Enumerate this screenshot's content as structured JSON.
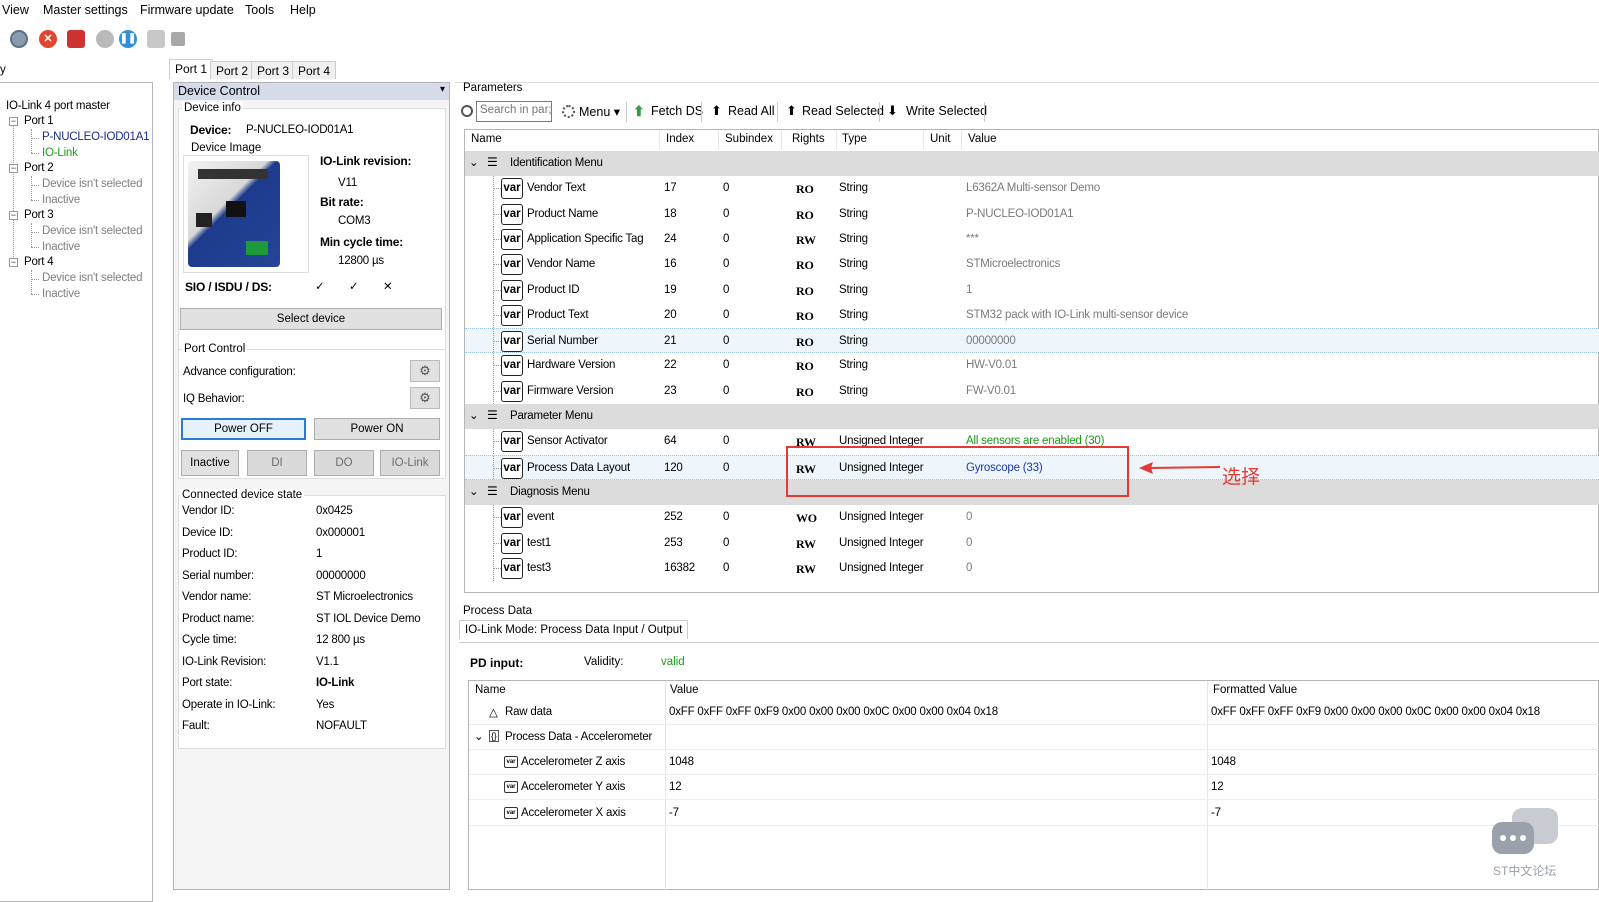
{
  "menubar": {
    "items": [
      "View",
      "Master settings",
      "Firmware update",
      "Tools",
      "Help"
    ]
  },
  "toolbar": {
    "icons": [
      "settings-gear-icon",
      "stop-red-icon",
      "disconnect-icon",
      "play-grey-icon",
      "pause-blue-icon",
      "wrench-icon",
      "plugin-icon"
    ]
  },
  "tree": {
    "fragment": "y",
    "root": "IO-Link 4 port master",
    "ports": [
      {
        "label": "Port 1",
        "device": "P-NUCLEO-IOD01A1",
        "mode": "IO-Link"
      },
      {
        "label": "Port 2",
        "device": "Device isn't selected",
        "mode": "Inactive"
      },
      {
        "label": "Port 3",
        "device": "Device isn't selected",
        "mode": "Inactive"
      },
      {
        "label": "Port 4",
        "device": "Device isn't selected",
        "mode": "Inactive"
      }
    ]
  },
  "port_tabs": [
    "Port 1",
    "Port 2",
    "Port 3",
    "Port 4"
  ],
  "device_control": {
    "title": "Device Control",
    "pin": "📌",
    "device_info_title": "Device info",
    "device_label": "Device:",
    "device_value": "P-NUCLEO-IOD01A1",
    "device_image_title": "Device Image",
    "iolink_rev_label": "IO-Link revision:",
    "iolink_rev_value": "V11",
    "bitrate_label": "Bit rate:",
    "bitrate_value": "COM3",
    "cycle_label": "Min cycle time:",
    "cycle_value": "12800 µs",
    "sio_label": "SIO / ISDU / DS:",
    "sio_values": [
      "✓",
      "✓",
      "✕"
    ],
    "select_device": "Select device",
    "port_control_title": "Port Control",
    "advance_config": "Advance configuration:",
    "iq_behavior": "IQ Behavior:",
    "power_off": "Power OFF",
    "power_on": "Power ON",
    "mode_buttons": [
      "Inactive",
      "DI",
      "DO",
      "IO-Link"
    ],
    "connected_title": "Connected device state",
    "state": [
      {
        "k": "Vendor ID:",
        "v": "0x0425"
      },
      {
        "k": "Device ID:",
        "v": "0x000001"
      },
      {
        "k": "Product ID:",
        "v": "1"
      },
      {
        "k": "Serial number:",
        "v": "00000000"
      },
      {
        "k": "Vendor name:",
        "v": "ST Microelectronics"
      },
      {
        "k": "Product name:",
        "v": "ST IOL Device Demo"
      },
      {
        "k": "Cycle time:",
        "v": "12 800 µs"
      },
      {
        "k": "IO-Link Revision:",
        "v": "V1.1"
      },
      {
        "k": "Port state:",
        "v": "IO-Link"
      },
      {
        "k": "Operate in IO-Link:",
        "v": "Yes"
      },
      {
        "k": "Fault:",
        "v": "NOFAULT"
      }
    ]
  },
  "parameters": {
    "title": "Parameters",
    "search_placeholder": "Search in par;",
    "menu": "Menu",
    "fetch_ds": "Fetch DS",
    "read_all": "Read All",
    "read_selected": "Read Selected",
    "write_selected": "Write Selected",
    "columns": [
      "Name",
      "Index",
      "Subindex",
      "Rights",
      "Type",
      "Unit",
      "Value"
    ],
    "groups": [
      {
        "name": "Identification Menu",
        "rows": [
          {
            "name": "Vendor Text",
            "index": "17",
            "sub": "0",
            "rights": "RO",
            "type": "String",
            "value": "L6362A Multi-sensor Demo"
          },
          {
            "name": "Product Name",
            "index": "18",
            "sub": "0",
            "rights": "RO",
            "type": "String",
            "value": "P-NUCLEO-IOD01A1"
          },
          {
            "name": "Application Specific Tag",
            "index": "24",
            "sub": "0",
            "rights": "RW",
            "type": "String",
            "value": "***"
          },
          {
            "name": "Vendor Name",
            "index": "16",
            "sub": "0",
            "rights": "RO",
            "type": "String",
            "value": "STMicroelectronics"
          },
          {
            "name": "Product ID",
            "index": "19",
            "sub": "0",
            "rights": "RO",
            "type": "String",
            "value": "1"
          },
          {
            "name": "Product Text",
            "index": "20",
            "sub": "0",
            "rights": "RO",
            "type": "String",
            "value": "STM32 pack with IO-Link multi-sensor device"
          },
          {
            "name": "Serial Number",
            "index": "21",
            "sub": "0",
            "rights": "RO",
            "type": "String",
            "value": "00000000"
          },
          {
            "name": "Hardware Version",
            "index": "22",
            "sub": "0",
            "rights": "RO",
            "type": "String",
            "value": "HW-V0.01"
          },
          {
            "name": "Firmware Version",
            "index": "23",
            "sub": "0",
            "rights": "RO",
            "type": "String",
            "value": "FW-V0.01"
          }
        ]
      },
      {
        "name": "Parameter Menu",
        "rows": [
          {
            "name": "Sensor Activator",
            "index": "64",
            "sub": "0",
            "rights": "RW",
            "type": "Unsigned Integer",
            "value": "All sensors are enabled (30)"
          },
          {
            "name": "Process Data Layout",
            "index": "120",
            "sub": "0",
            "rights": "RW",
            "type": "Unsigned Integer",
            "value": "Gyroscope (33)"
          }
        ]
      },
      {
        "name": "Diagnosis Menu",
        "rows": [
          {
            "name": "event",
            "index": "252",
            "sub": "0",
            "rights": "WO",
            "type": "Unsigned Integer",
            "value": "0"
          },
          {
            "name": "test1",
            "index": "253",
            "sub": "0",
            "rights": "RW",
            "type": "Unsigned Integer",
            "value": "0"
          },
          {
            "name": "test3",
            "index": "16382",
            "sub": "0",
            "rights": "RW",
            "type": "Unsigned Integer",
            "value": "0"
          }
        ]
      }
    ],
    "var_label": "var"
  },
  "annotation": {
    "text": "选择",
    "color": "#e53935"
  },
  "process_data": {
    "title": "Process Data",
    "tab": "IO-Link Mode: Process Data Input / Output",
    "pd_input": "PD input:",
    "validity_label": "Validity:",
    "validity_value": "valid",
    "columns": [
      "Name",
      "Value",
      "Formatted Value"
    ],
    "raw": {
      "name": "Raw data",
      "value": "0xFF 0xFF 0xFF 0xF9 0x00 0x00 0x00 0x0C 0x00 0x00 0x04 0x18",
      "formatted": "0xFF 0xFF 0xFF 0xF9 0x00 0x00 0x00 0x0C 0x00 0x00 0x04 0x18"
    },
    "group": "Process Data - Accelerometer",
    "rows": [
      {
        "name": "Accelerometer Z axis",
        "value": "1048",
        "formatted": "1048"
      },
      {
        "name": "Accelerometer Y axis",
        "value": "12",
        "formatted": "12"
      },
      {
        "name": "Accelerometer X axis",
        "value": "-7",
        "formatted": "-7"
      }
    ]
  },
  "watermark": {
    "text": "ST中文论坛"
  }
}
